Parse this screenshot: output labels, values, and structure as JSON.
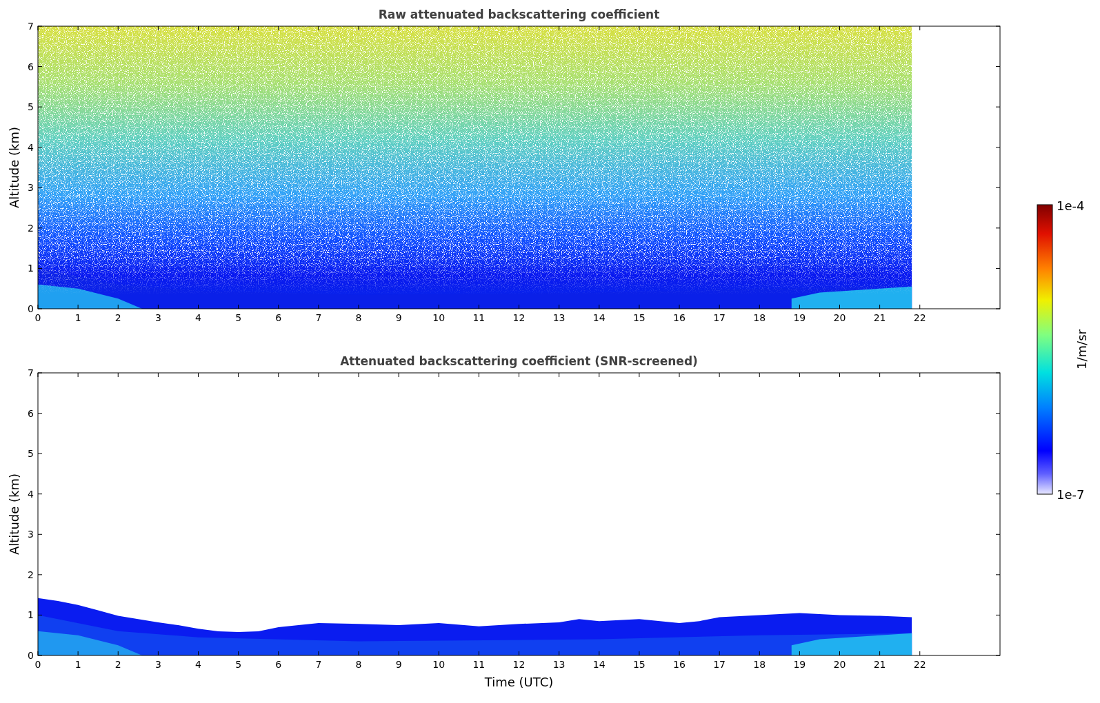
{
  "panels": [
    {
      "kind": "raw",
      "title": "Raw attenuated backscattering coefficient",
      "ylabel": "Altitude (km)",
      "yticks": [
        "7",
        "6",
        "5",
        "4",
        "3",
        "2",
        "1",
        "0"
      ],
      "xticks": [
        "0",
        "1",
        "2",
        "3",
        "4",
        "5",
        "6",
        "7",
        "8",
        "9",
        "10",
        "11",
        "12",
        "13",
        "14",
        "15",
        "16",
        "17",
        "18",
        "19",
        "20",
        "21",
        "22"
      ]
    },
    {
      "kind": "screened",
      "title": "Attenuated backscattering coefficient (SNR-screened)",
      "ylabel": "Altitude (km)",
      "xlabel": "Time (UTC)",
      "yticks": [
        "7",
        "6",
        "5",
        "4",
        "3",
        "2",
        "1",
        "0"
      ],
      "xticks": [
        "0",
        "1",
        "2",
        "3",
        "4",
        "5",
        "6",
        "7",
        "8",
        "9",
        "10",
        "11",
        "12",
        "13",
        "14",
        "15",
        "16",
        "17",
        "18",
        "19",
        "20",
        "21",
        "22"
      ]
    }
  ],
  "colorbar": {
    "max_label": "1e-4",
    "min_label": "1e-7",
    "label": "1/m/sr"
  }
}
